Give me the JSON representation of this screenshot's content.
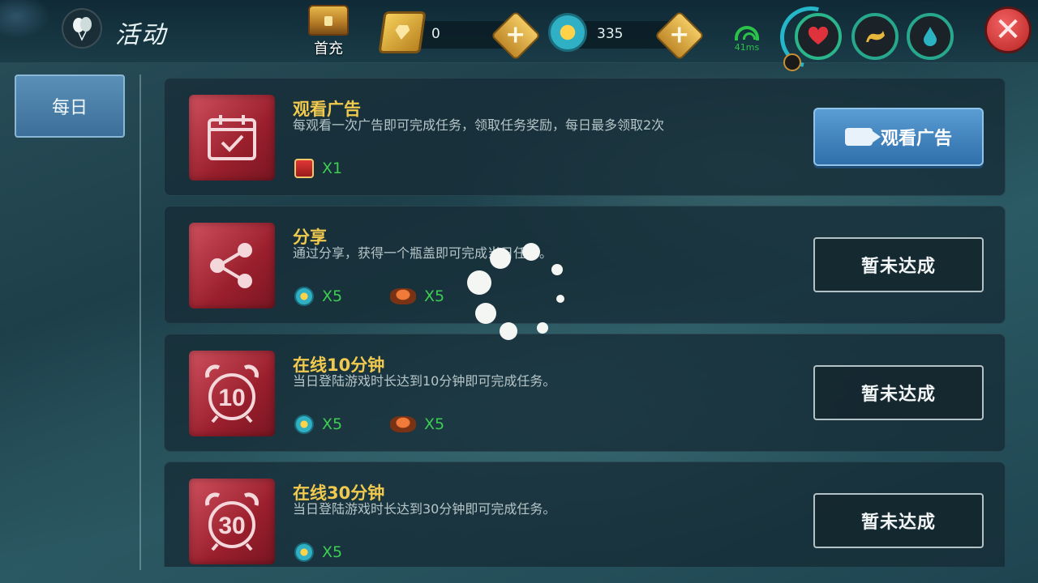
{
  "header": {
    "title": "活动",
    "first_charge_label": "首充",
    "gem_value": "0",
    "coin_value": "335",
    "ping": "41ms"
  },
  "sidebar": {
    "tabs": [
      {
        "label": "每日"
      }
    ]
  },
  "tasks": [
    {
      "title": "观看广告",
      "desc": "每观看一次广告即可完成任务，领取任务奖励，每日最多领取2次",
      "rewards": [
        {
          "icon": "gift-icon",
          "count": "X1"
        }
      ],
      "button": "观看广告"
    },
    {
      "title": "分享",
      "desc": "通过分享，获得一个瓶盖即可完成当日任务。",
      "rewards": [
        {
          "icon": "coin-icon",
          "count": "X5"
        },
        {
          "icon": "bottle-cap-icon",
          "count": "X5"
        }
      ],
      "button": "暂未达成"
    },
    {
      "title": "在线10分钟",
      "desc": "当日登陆游戏时长达到10分钟即可完成任务。",
      "rewards": [
        {
          "icon": "coin-icon",
          "count": "X5"
        },
        {
          "icon": "bottle-cap-icon",
          "count": "X5"
        }
      ],
      "button": "暂未达成",
      "icon_number": "10"
    },
    {
      "title": "在线30分钟",
      "desc": "当日登陆游戏时长达到30分钟即可完成任务。",
      "rewards": [
        {
          "icon": "coin-icon",
          "count": "X5"
        }
      ],
      "button": "暂未达成",
      "icon_number": "30"
    }
  ],
  "colors": {
    "task_title": "#f1c94e",
    "reward_count": "#3ccd52",
    "ad_button": "#3f82c0",
    "close_button": "#d23a3a",
    "ping_green": "#2bc24a"
  }
}
